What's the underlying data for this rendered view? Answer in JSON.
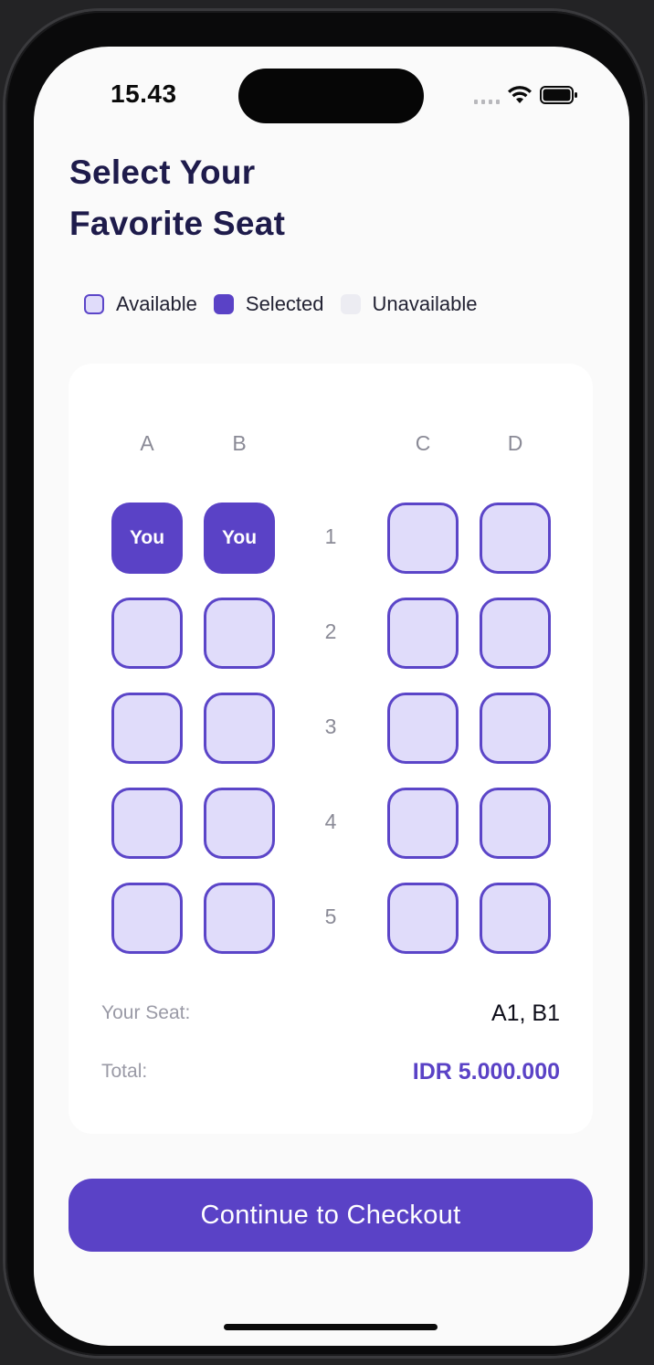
{
  "status_bar": {
    "time": "15.43"
  },
  "header": {
    "title_line1": "Select Your",
    "title_line2": "Favorite Seat"
  },
  "legend": {
    "available": "Available",
    "selected": "Selected",
    "unavailable": "Unavailable"
  },
  "seat_map": {
    "columns": [
      "A",
      "B",
      "C",
      "D"
    ],
    "rows": [
      "1",
      "2",
      "3",
      "4",
      "5"
    ],
    "selected_label": "You",
    "seats": [
      [
        "selected",
        "selected",
        "available",
        "available"
      ],
      [
        "available",
        "available",
        "available",
        "available"
      ],
      [
        "available",
        "available",
        "available",
        "available"
      ],
      [
        "available",
        "available",
        "available",
        "available"
      ],
      [
        "available",
        "available",
        "available",
        "available"
      ]
    ]
  },
  "summary": {
    "seat_label": "Your Seat:",
    "seat_value": "A1, B1",
    "total_label": "Total:",
    "total_value": "IDR 5.000.000"
  },
  "cta": {
    "label": "Continue to Checkout"
  },
  "colors": {
    "accent": "#5a42c6",
    "available_fill": "#e0dcfa",
    "unavailable_fill": "#ececf2",
    "title": "#1e1b4b"
  },
  "icons": [
    "signal-icon",
    "wifi-icon",
    "battery-icon"
  ]
}
